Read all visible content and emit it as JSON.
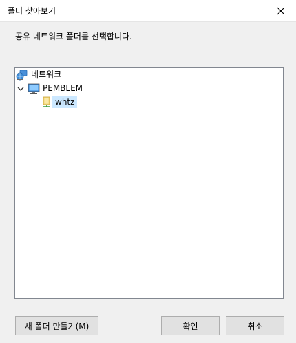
{
  "window": {
    "title": "폴더 찾아보기",
    "instruction": "공유 네트워크 폴더를 선택합니다."
  },
  "tree": {
    "root": {
      "label": "네트워크",
      "icon": "network-icon"
    },
    "computer": {
      "label": "PEMBLEM",
      "icon": "computer-icon",
      "expanded": true
    },
    "folder": {
      "label": "whtz",
      "icon": "shared-folder-icon",
      "selected": true
    }
  },
  "buttons": {
    "new_folder": "새 폴더 만들기(M)",
    "ok": "확인",
    "cancel": "취소"
  },
  "colors": {
    "selection": "#cce8ff",
    "tree_border": "#828790",
    "button_face": "#e1e1e1"
  }
}
